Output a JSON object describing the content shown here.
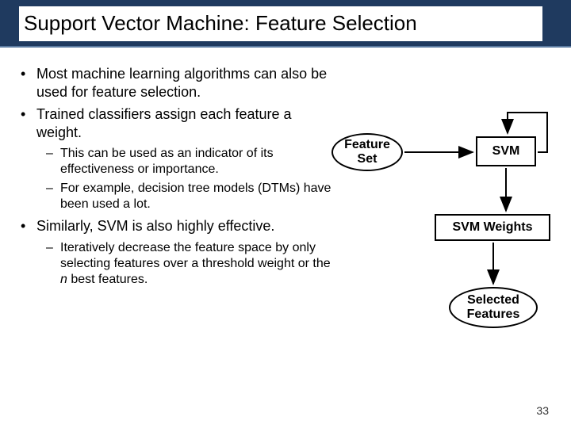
{
  "title": "Support Vector Machine: Feature Selection",
  "bullets": {
    "b1": "Most machine learning algorithms can also be used for feature selection.",
    "b2": "Trained classifiers assign each feature a weight.",
    "b2s1": "This can be used as an indicator of its effectiveness or importance.",
    "b2s2": "For example, decision tree models (DTMs) have been used a lot.",
    "b3": "Similarly, SVM is also highly effective.",
    "b3s1_a": "Iteratively decrease the feature space by only selecting features over a threshold weight or the ",
    "b3s1_n": "n",
    "b3s1_b": " best features."
  },
  "diagram": {
    "feature_set": "Feature Set",
    "svm": "SVM",
    "weights": "SVM Weights",
    "selected": "Selected Features"
  },
  "page": "33"
}
